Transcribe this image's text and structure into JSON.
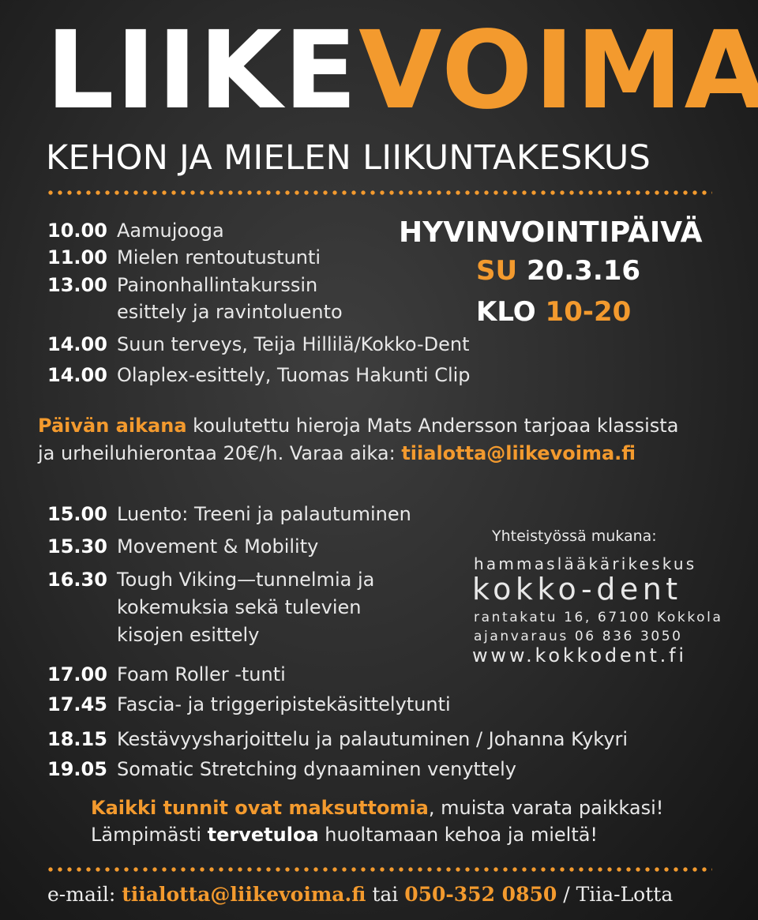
{
  "logo": {
    "part1": "LIIKE",
    "part2": "VOIMA"
  },
  "subtitle": "KEHON JA MIELEN LIIKUNTAKESKUS",
  "event": {
    "title": "HYVINVOINTIPÄIVÄ",
    "day": "SU",
    "date": "20.3.16",
    "klo": "KLO",
    "hours": "10-20"
  },
  "schedule_morning": [
    {
      "time": "10.00",
      "activity": "Aamujooga"
    },
    {
      "time": "11.00",
      "activity": "Mielen rentoutustunti"
    },
    {
      "time": "13.00",
      "activity": "Painonhallintakurssin",
      "activity_line2": "esittely ja ravintoluento"
    },
    {
      "time": "14.00",
      "activity": "Suun terveys, Teija Hillilä/Kokko-Dent"
    },
    {
      "time": "14.00",
      "activity": "Olaplex-esittely, Tuomas Hakunti Clip"
    }
  ],
  "massage": {
    "highlight": "Päivän aikana",
    "text1": " koulutettu hieroja Mats Andersson tarjoaa klassista",
    "text2": "ja urheiluhierontaa 20€/h. Varaa aika: ",
    "email": "tiialotta@liikevoima.fi"
  },
  "schedule_afternoon": [
    {
      "time": "15.00",
      "activity": "Luento: Treeni ja palautuminen"
    },
    {
      "time": "15.30",
      "activity": "Movement & Mobility"
    },
    {
      "time": "16.30",
      "activity": "Tough Viking—tunnelmia ja",
      "activity_line2": "kokemuksia sekä tulevien",
      "activity_line3": "kisojen esittely"
    },
    {
      "time": "17.00",
      "activity": "Foam Roller -tunti"
    },
    {
      "time": "17.45",
      "activity": "Fascia- ja triggeripistekäsittelytunti"
    },
    {
      "time": "18.15",
      "activity": "Kestävyysharjoittelu ja palautuminen / Johanna Kykyri"
    },
    {
      "time": "19.05",
      "activity": "Somatic Stretching dynaaminen venyttely"
    }
  ],
  "partner": {
    "lead": "Yhteistyössä mukana:",
    "name_line1": "hammaslääkärikeskus",
    "name_line2": "kokko-dent",
    "address": "rantakatu 16, 67100 Kokkola",
    "booking": "ajanvaraus  06 836 3050",
    "website": "www.kokkodent.fi"
  },
  "closing": {
    "highlight": "Kaikki tunnit ovat maksuttomia",
    "text1": ", muista varata paikkasi!",
    "text2a": "Lämpimästi ",
    "text2b": "tervetuloa",
    "text2c": " huoltamaan kehoa ja mieltä!"
  },
  "contact": {
    "label": "e-mail: ",
    "email": "tiialotta@liikevoima.fi",
    "sep": " tai ",
    "phone": "050-352 0850",
    "name": " / Tiia-Lotta"
  },
  "colors": {
    "accent": "#f39a2e",
    "text": "#ececec",
    "background": "#2c2c2c"
  }
}
